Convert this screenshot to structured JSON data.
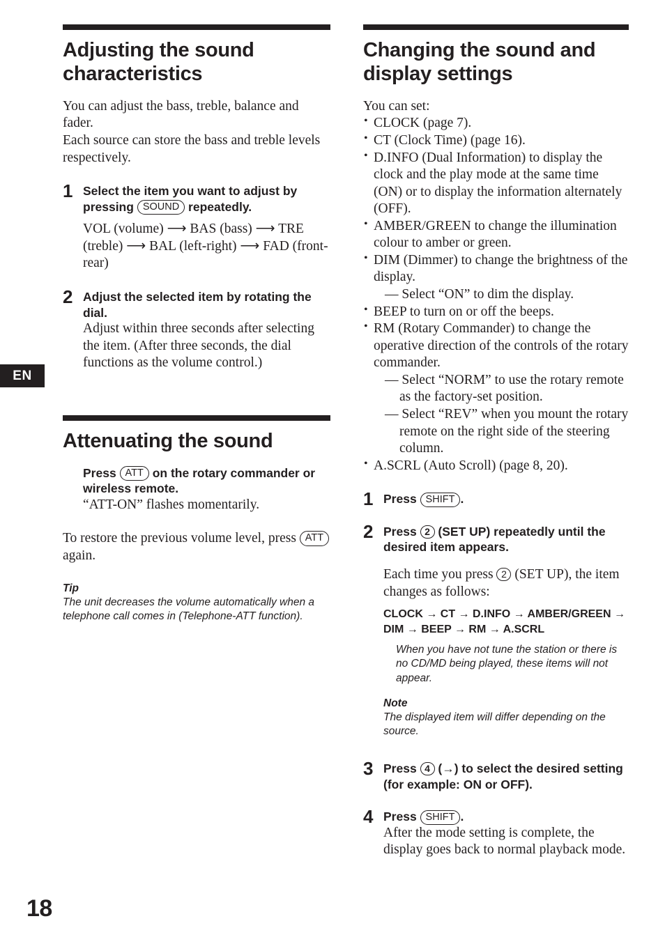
{
  "page": {
    "number": "18",
    "language_tab": "EN"
  },
  "left_column": {
    "section1": {
      "title": "Adjusting the sound characteristics",
      "intro_line1": "You can adjust the bass, treble, balance and fader.",
      "intro_line2": "Each source can store the bass and treble levels respectively.",
      "step1": {
        "number": "1",
        "title_part1": "Select the item you want to adjust by pressing ",
        "key": "SOUND",
        "title_part2": " repeatedly.",
        "sequence": "VOL (volume)  ⟶ BAS (bass) ⟶ TRE (treble) ⟶ BAL (left-right) ⟶  FAD (front-rear)"
      },
      "step2": {
        "number": "2",
        "title": "Adjust the selected item by rotating the dial.",
        "body": "Adjust within three seconds after selecting the item. (After three seconds, the dial functions as the volume control.)"
      }
    },
    "section2": {
      "title": "Attenuating the sound",
      "instruction_part1": "Press ",
      "instruction_key": "ATT",
      "instruction_part2": " on the rotary commander or wireless remote.",
      "instruction_body": "“ATT-ON” flashes momentarily.",
      "restore_part1": "To restore the previous volume level, press ",
      "restore_key": "ATT",
      "restore_part2": " again.",
      "tip_label": "Tip",
      "tip_text": "The unit decreases the volume automatically when a telephone call comes in (Telephone-ATT function)."
    }
  },
  "right_column": {
    "section1": {
      "title": "Changing the sound and display settings",
      "intro": "You can set:",
      "bullets": [
        {
          "text": "CLOCK (page 7)."
        },
        {
          "text": "CT (Clock Time) (page 16)."
        },
        {
          "text": "D.INFO (Dual Information) to display the clock and the play mode at the same time (ON) or to display the information alternately (OFF)."
        },
        {
          "text": "AMBER/GREEN to change the illumination colour to amber or green."
        },
        {
          "text": "DIM (Dimmer) to change the brightness of the display.",
          "subs": [
            "— Select “ON” to dim the display."
          ]
        },
        {
          "text": "BEEP to turn on or off the beeps."
        },
        {
          "text": "RM (Rotary Commander) to change the operative direction of the controls of the rotary commander.",
          "subs": [
            "— Select “NORM” to use the rotary remote as the factory-set position.",
            "— Select “REV” when you mount the rotary remote on the right side of the steering column."
          ]
        },
        {
          "text": "A.SCRL (Auto Scroll) (page 8, 20)."
        }
      ],
      "step1": {
        "number": "1",
        "title_part1": "Press ",
        "key": "SHIFT",
        "title_part2": "."
      },
      "step2": {
        "number": "2",
        "title_part1": "Press ",
        "key_circle": "2",
        "title_part2": " (SET UP) repeatedly until the desired item appears.",
        "body_part1": "Each time you press ",
        "body_key_circle": "2",
        "body_part2": " (SET UP), the item changes as follows:",
        "flow_line1": "CLOCK → CT → D.INFO  → AMBER/GREEN →",
        "flow_line2": "DIM  → BEEP → RM → A.SCRL",
        "note_italic": "When you have not tune the station or there is no CD/MD being played, these items will not appear.",
        "note_label": "Note",
        "note_text": "The displayed item will differ depending on the source."
      },
      "step3": {
        "number": "3",
        "title_part1": "Press ",
        "key_circle": "4",
        "title_part2": " (→) to select the desired setting (for example: ON or OFF)."
      },
      "step4": {
        "number": "4",
        "title_part1": "Press ",
        "key": "SHIFT",
        "title_part2": ".",
        "body": "After the mode setting is complete, the display goes back to normal playback mode."
      }
    }
  }
}
